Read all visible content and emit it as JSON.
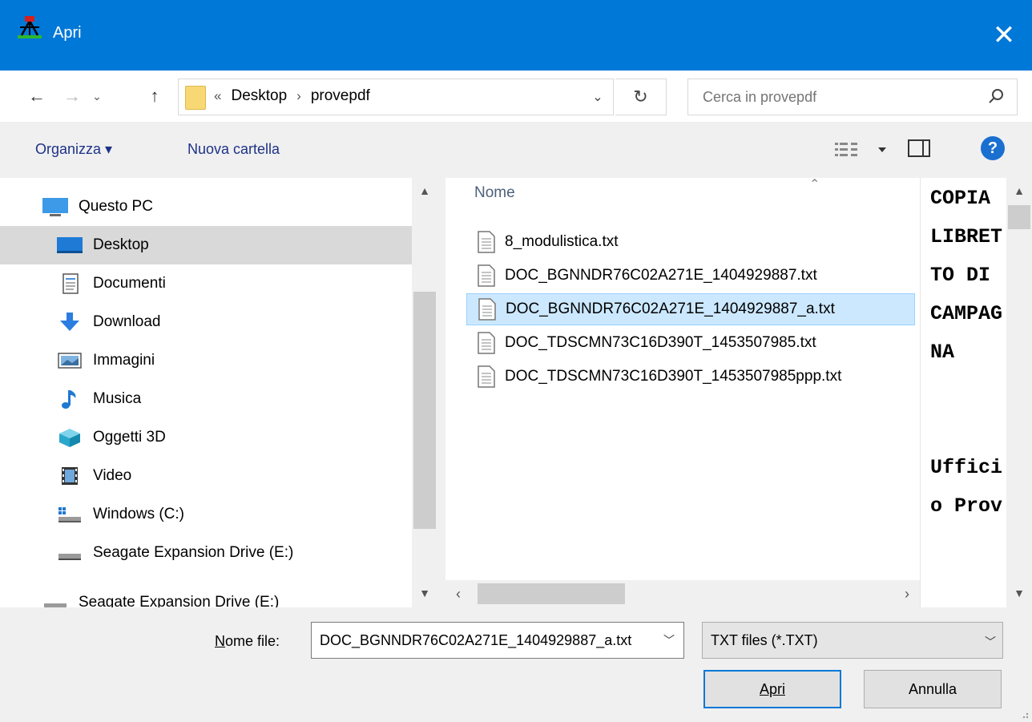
{
  "window": {
    "title": "Apri",
    "close_label": "✕"
  },
  "nav": {
    "back_icon": "←",
    "forward_icon": "→",
    "recent_icon": "⌄",
    "up_icon": "↑"
  },
  "address": {
    "prefix": "«",
    "crumbs": [
      "Desktop",
      "provepdf"
    ],
    "separator": "›",
    "dropdown_icon": "⌄",
    "refresh_icon": "↻"
  },
  "search": {
    "placeholder": "Cerca in provepdf"
  },
  "commands": {
    "organize": "Organizza ▾",
    "new_folder": "Nuova cartella",
    "help": "?"
  },
  "sidebar": {
    "items": [
      {
        "label": "Questo PC",
        "icon": "pc-icon"
      },
      {
        "label": "Desktop",
        "icon": "desktop-icon",
        "selected": true
      },
      {
        "label": "Documenti",
        "icon": "documents-icon"
      },
      {
        "label": "Download",
        "icon": "download-icon"
      },
      {
        "label": "Immagini",
        "icon": "pictures-icon"
      },
      {
        "label": "Musica",
        "icon": "music-icon"
      },
      {
        "label": "Oggetti 3D",
        "icon": "3d-objects-icon"
      },
      {
        "label": "Video",
        "icon": "video-icon"
      },
      {
        "label": "Windows (C:)",
        "icon": "windows-drive-icon"
      },
      {
        "label": "Seagate Expansion Drive (E:)",
        "icon": "drive-icon"
      },
      {
        "label": "Seagate Expansion Drive (E:)",
        "icon": "drive-icon"
      }
    ]
  },
  "filelist": {
    "column_name": "Nome",
    "files": [
      {
        "name": "8_modulistica.txt",
        "selected": false
      },
      {
        "name": "DOC_BGNNDR76C02A271E_1404929887.txt",
        "selected": false
      },
      {
        "name": "DOC_BGNNDR76C02A271E_1404929887_a.txt",
        "selected": true
      },
      {
        "name": "DOC_TDSCMN73C16D390T_1453507985.txt",
        "selected": false
      },
      {
        "name": "DOC_TDSCMN73C16D390T_1453507985ppp.txt",
        "selected": false
      }
    ]
  },
  "preview": {
    "text": "COPIA LIBRETTO DI CAMPAGNA\n\n\nUfficio Prov"
  },
  "bottom": {
    "filename_label_underlined": "N",
    "filename_label_rest": "ome file:",
    "filename_value": "DOC_BGNNDR76C02A271E_1404929887_a.txt",
    "filetype_value": "TXT files (*.TXT)",
    "open_label": "Apri",
    "cancel_label": "Annulla"
  },
  "colors": {
    "accent": "#0078d7",
    "selection": "#cce8ff",
    "link": "#1e3287"
  }
}
